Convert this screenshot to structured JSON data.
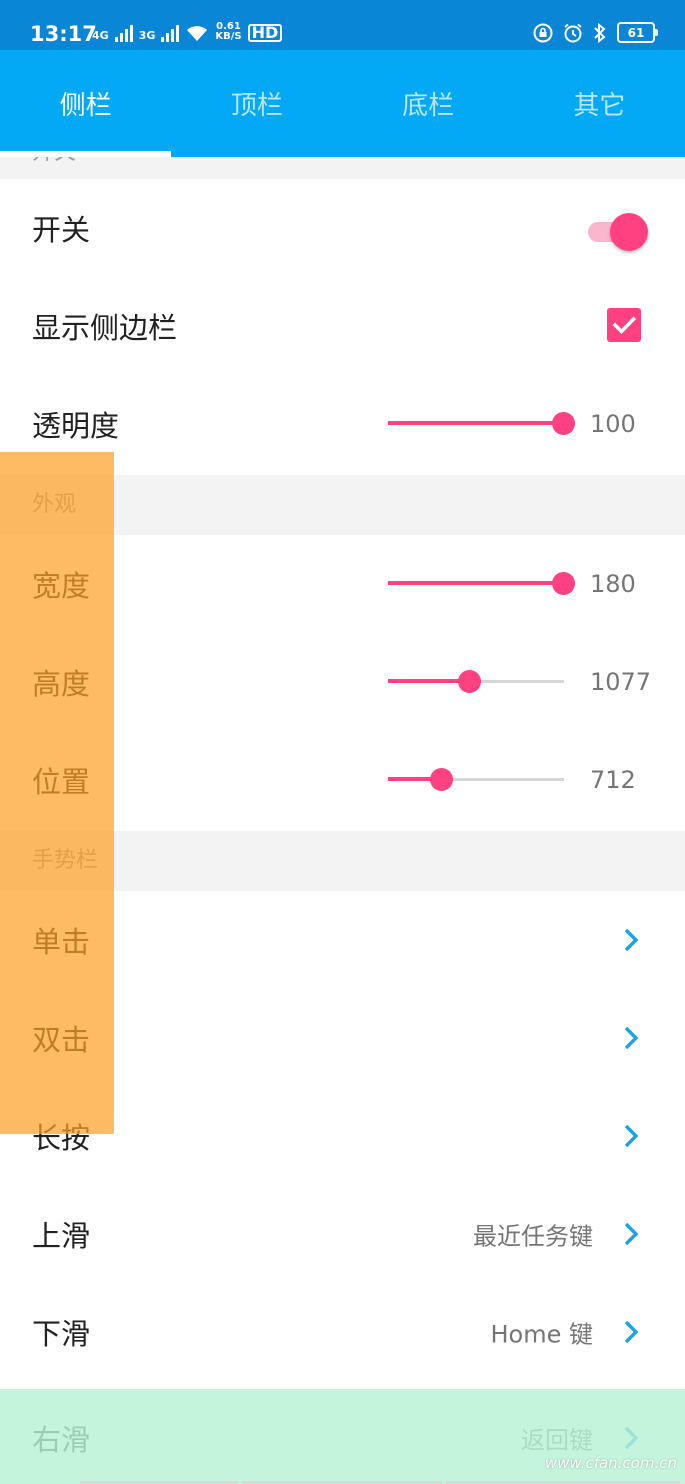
{
  "status_bar": {
    "time": "13:17",
    "net1": "4G",
    "net2": "3G",
    "speed_value": "0.61",
    "speed_unit": "KB/S",
    "hd": "HD",
    "battery": "61"
  },
  "tabs": [
    {
      "label": "侧栏",
      "active": true
    },
    {
      "label": "顶栏",
      "active": false
    },
    {
      "label": "底栏",
      "active": false
    },
    {
      "label": "其它",
      "active": false
    }
  ],
  "sections": {
    "switch_header": "开关",
    "appearance_header": "外观",
    "gesture_header": "手势栏"
  },
  "switch_rows": {
    "switch_label": "开关",
    "switch_on": true,
    "show_sidebar_label": "显示侧边栏",
    "show_sidebar_checked": true,
    "opacity_label": "透明度",
    "opacity_value": "100",
    "opacity_fraction": 1.0
  },
  "appearance_rows": {
    "width_label": "宽度",
    "width_value": "180",
    "width_fraction": 1.0,
    "height_label": "高度",
    "height_value": "1077",
    "height_fraction": 0.46,
    "position_label": "位置",
    "position_value": "712",
    "position_fraction": 0.3
  },
  "gesture_rows": [
    {
      "label": "单击",
      "value": ""
    },
    {
      "label": "双击",
      "value": ""
    },
    {
      "label": "长按",
      "value": ""
    },
    {
      "label": "上滑",
      "value": "最近任务键"
    },
    {
      "label": "下滑",
      "value": "Home 键"
    },
    {
      "label": "右滑",
      "value": "返回键"
    }
  ],
  "watermark": "www.cfan.com.cn",
  "colors": {
    "status_bar": "#0a86d6",
    "tab_bar": "#03a9f4",
    "accent": "#ff4081",
    "chevron": "#1aa3e8"
  }
}
